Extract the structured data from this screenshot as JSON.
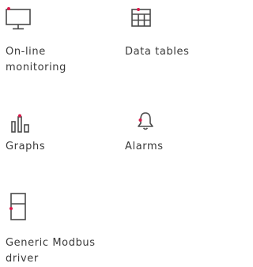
{
  "accent_color": "#d81b4b",
  "icon_color": "#4a4a4a",
  "features": [
    {
      "icon": "monitor-icon",
      "label_line1": "On-line",
      "label_line2": "monitoring"
    },
    {
      "icon": "table-icon",
      "label_line1": "Data tables"
    },
    {
      "icon": "bar-chart-icon",
      "label_line1": "Graphs"
    },
    {
      "icon": "bell-icon",
      "label_line1": "Alarms"
    },
    {
      "icon": "device-icon",
      "label_line1": "Generic Modbus",
      "label_line2": "driver"
    }
  ]
}
